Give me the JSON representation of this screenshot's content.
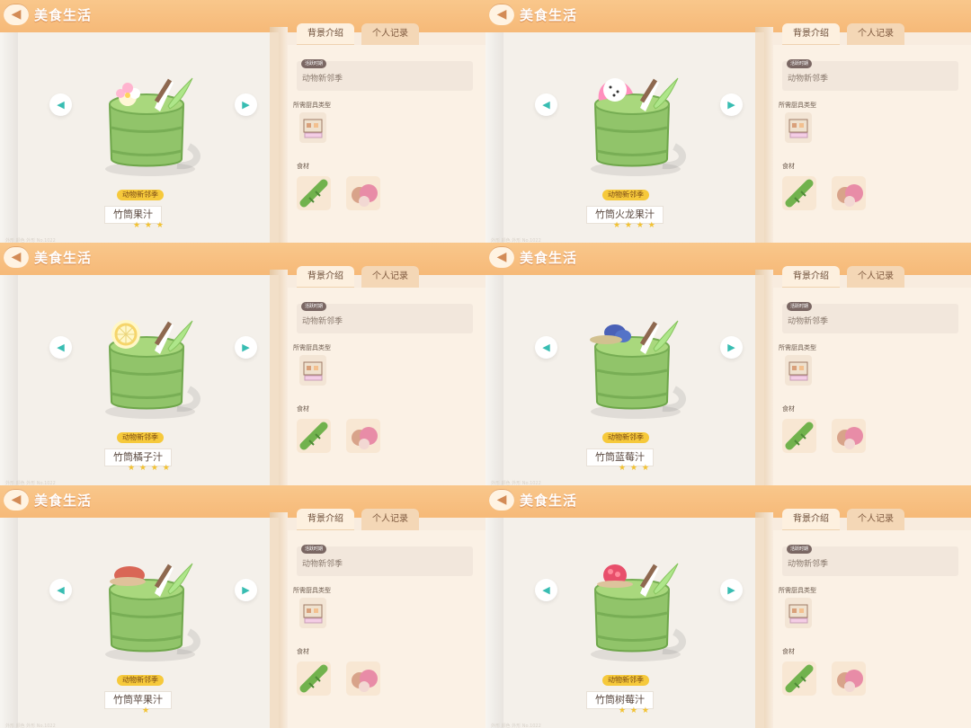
{
  "header": {
    "title": "美食生活",
    "back_icon": "back-arrow-icon"
  },
  "tabs": {
    "active": "背景介绍",
    "inactive": "个人记录"
  },
  "labels": {
    "season_pill": "活跃时期",
    "tools": "所需厨具类型",
    "ingredients": "食材",
    "tiny_footer": "外形  颜色  外形  No.1022"
  },
  "recipes": [
    {
      "name": "竹筒果汁",
      "badge": "动物新邻季",
      "season": "动物新邻季",
      "stars": "★ ★ ★",
      "star_count": 3,
      "theme": "flower",
      "ingredients": [
        "bamboo-icon",
        "fruit-cake-icon"
      ]
    },
    {
      "name": "竹筒火龙果汁",
      "badge": "动物新邻季",
      "season": "动物新邻季",
      "stars": "★ ★ ★ ★",
      "star_count": 4,
      "theme": "dragonfruit",
      "ingredients": [
        "bamboo-icon",
        "dragon-fruit-icon"
      ]
    },
    {
      "name": "竹筒橘子汁",
      "badge": "动物新邻季",
      "season": "动物新邻季",
      "stars": "★ ★ ★ ★",
      "star_count": 4,
      "theme": "orange",
      "ingredients": [
        "bamboo-icon",
        "orange-fruit-icon"
      ]
    },
    {
      "name": "竹筒蓝莓汁",
      "badge": "动物新邻季",
      "season": "动物新邻季",
      "stars": "★ ★ ★",
      "star_count": 3,
      "theme": "blueberry",
      "ingredients": [
        "bamboo-icon",
        "blueberry-icon"
      ]
    },
    {
      "name": "竹筒苹果汁",
      "badge": "动物新邻季",
      "season": "动物新邻季",
      "stars": "★",
      "star_count": 1,
      "theme": "apple",
      "ingredients": [
        "bamboo-icon",
        "apple-icon"
      ]
    },
    {
      "name": "竹筒树莓汁",
      "badge": "动物新邻季",
      "season": "动物新邻季",
      "stars": "★ ★ ★",
      "star_count": 3,
      "theme": "raspberry",
      "ingredients": [
        "bamboo-icon",
        "raspberry-icon"
      ]
    }
  ]
}
